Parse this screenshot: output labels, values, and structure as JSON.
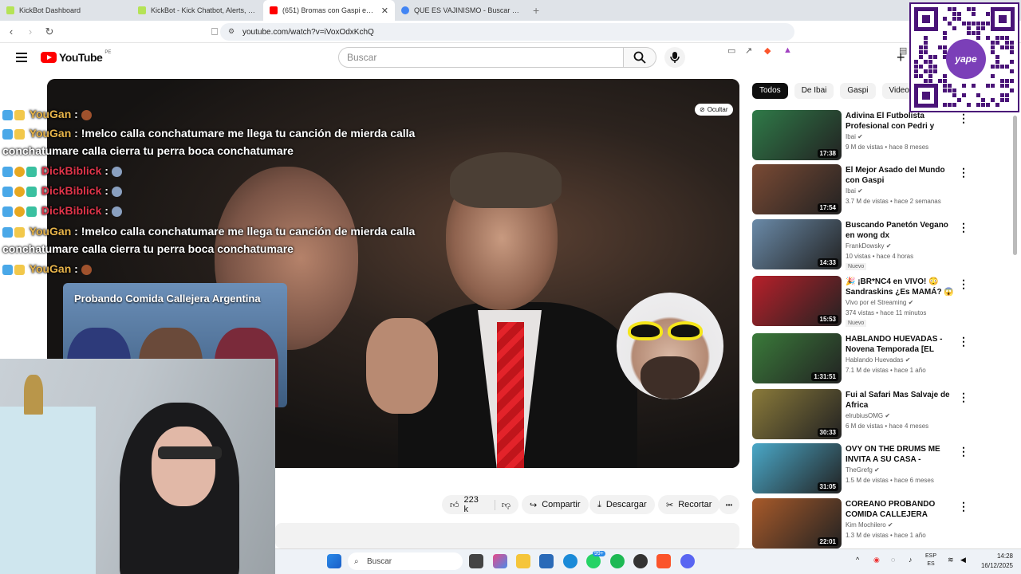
{
  "browser": {
    "tabs": [
      {
        "title": "KickBot Dashboard",
        "favicon_color": "#b5e356"
      },
      {
        "title": "KickBot - Kick Chatbot, Alerts, TTS, Ch",
        "favicon_color": "#b5e356"
      },
      {
        "title": "(651) Bromas con Gaspi en Perú",
        "favicon_color": "#ff0000"
      },
      {
        "title": "QUE ES VAJINISMO - Buscar con Goo",
        "favicon_color": "#4285f4"
      }
    ],
    "new_tab": "+",
    "url": "youtube.com/watch?v=iVoxOdxKchQ"
  },
  "youtube": {
    "logo_text": "YouTube",
    "country_code": "PE",
    "search_placeholder": "Buscar",
    "hide_label": "Ocultar"
  },
  "chat": [
    {
      "user": "YouGan",
      "text": " : ",
      "emote": true
    },
    {
      "user": "YouGan",
      "text": " : !melco calla conchatumare me llega tu canción de mierda calla conchatumare calla cierra tu perra boca conchatumare"
    },
    {
      "user": "DickBiblick",
      "text": " : ",
      "emote": true
    },
    {
      "user": "DickBiblick",
      "text": " : ",
      "emote": true
    },
    {
      "user": "DickBiblick",
      "text": " : ",
      "emote": true
    },
    {
      "user": "YouGan",
      "text": " : !melco calla conchatumare me llega tu canción de mierda calla conchatumare calla cierra tu perra boca conchatumare"
    },
    {
      "user": "YouGan",
      "text": " : ",
      "emote": true
    }
  ],
  "overlay_thumb_title": "Probando Comida Callejera Argentina",
  "actions": {
    "likes": "223 k",
    "share": "Compartir",
    "download": "Descargar",
    "clip": "Recortar",
    "more": "•••"
  },
  "chips": [
    "Todos",
    "De Ibai",
    "Gaspi",
    "Videos rela"
  ],
  "recommendations": [
    {
      "title": "Adivina El Futbolista Profesional con Pedri y Ferran ...",
      "channel": "Ibai",
      "meta": "9 M de vistas • hace 8 meses",
      "duration": "17:38",
      "thumb_color": "#2f7a48",
      "new": false
    },
    {
      "title": "El Mejor Asado del Mundo con Gaspi",
      "channel": "Ibai",
      "meta": "3.7 M de vistas • hace 2 semanas",
      "duration": "17:54",
      "thumb_color": "#7a4a34",
      "new": false
    },
    {
      "title": "Buscando Panetón Vegano en wong dx",
      "channel": "FrankDowsky",
      "meta": "10 vistas • hace 4 horas",
      "duration": "14:33",
      "thumb_color": "#6a8aa8",
      "new": true
    },
    {
      "title": "🎉 ¡BR*NC4 en VIVO! 😳 Sandraskins ¿Es MAMÁ? 😱 | ...",
      "channel": "Vivo por el Streaming",
      "meta": "374 vistas • hace 11 minutos",
      "duration": "15:53",
      "thumb_color": "#b8202a",
      "new": true
    },
    {
      "title": "HABLANDO HUEVADAS - Novena Temporada [EL CHICO ...",
      "channel": "Hablando Huevadas",
      "meta": "7.1 M de vistas • hace 1 año",
      "duration": "1:31:51",
      "thumb_color": "#3a7a3a",
      "new": false
    },
    {
      "title": "Fui al Safari Mas Salvaje de Africa",
      "channel": "elrubiusOMG",
      "meta": "6 M de vistas • hace 4 meses",
      "duration": "30:33",
      "thumb_color": "#8a7a3a",
      "new": false
    },
    {
      "title": "OVY ON THE DRUMS ME INVITA A SU CASA - TheGrefg",
      "channel": "TheGrefg",
      "meta": "1.5 M de vistas • hace 6 meses",
      "duration": "31:05",
      "thumb_color": "#4aa8c8",
      "new": false
    },
    {
      "title": "COREANO PROBANDO COMIDA CALLEJERA PERUANA EN ...",
      "channel": "Kim Mochilero",
      "meta": "1.3 M de vistas • hace 1 año",
      "duration": "22:01",
      "thumb_color": "#a85a2a",
      "new": false
    }
  ],
  "qr_label": "yape",
  "taskbar": {
    "search": "Buscar",
    "lang_top": "ESP",
    "lang_bottom": "ES",
    "time": "14:28",
    "date": "16/12/2025",
    "badge_whatsapp": "99+"
  }
}
